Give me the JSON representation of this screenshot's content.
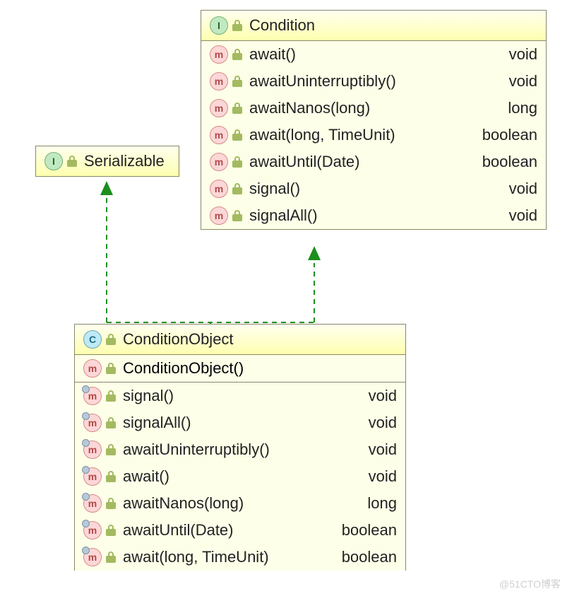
{
  "serializable": {
    "name": "Serializable",
    "kind": "I"
  },
  "condition": {
    "name": "Condition",
    "kind": "I",
    "methods": [
      {
        "name": "await()",
        "ret": "void"
      },
      {
        "name": "awaitUninterruptibly()",
        "ret": "void"
      },
      {
        "name": "awaitNanos(long)",
        "ret": "long"
      },
      {
        "name": "await(long, TimeUnit)",
        "ret": "boolean"
      },
      {
        "name": "awaitUntil(Date)",
        "ret": "boolean"
      },
      {
        "name": "signal()",
        "ret": "void"
      },
      {
        "name": "signalAll()",
        "ret": "void"
      }
    ]
  },
  "conditionObject": {
    "name": "ConditionObject",
    "kind": "C",
    "constructor": "ConditionObject()",
    "methods": [
      {
        "name": "signal()",
        "ret": "void"
      },
      {
        "name": "signalAll()",
        "ret": "void"
      },
      {
        "name": "awaitUninterruptibly()",
        "ret": "void"
      },
      {
        "name": "await()",
        "ret": "void"
      },
      {
        "name": "awaitNanos(long)",
        "ret": "long"
      },
      {
        "name": "awaitUntil(Date)",
        "ret": "boolean"
      },
      {
        "name": "await(long, TimeUnit)",
        "ret": "boolean"
      }
    ]
  },
  "watermark": "@51CTO博客"
}
